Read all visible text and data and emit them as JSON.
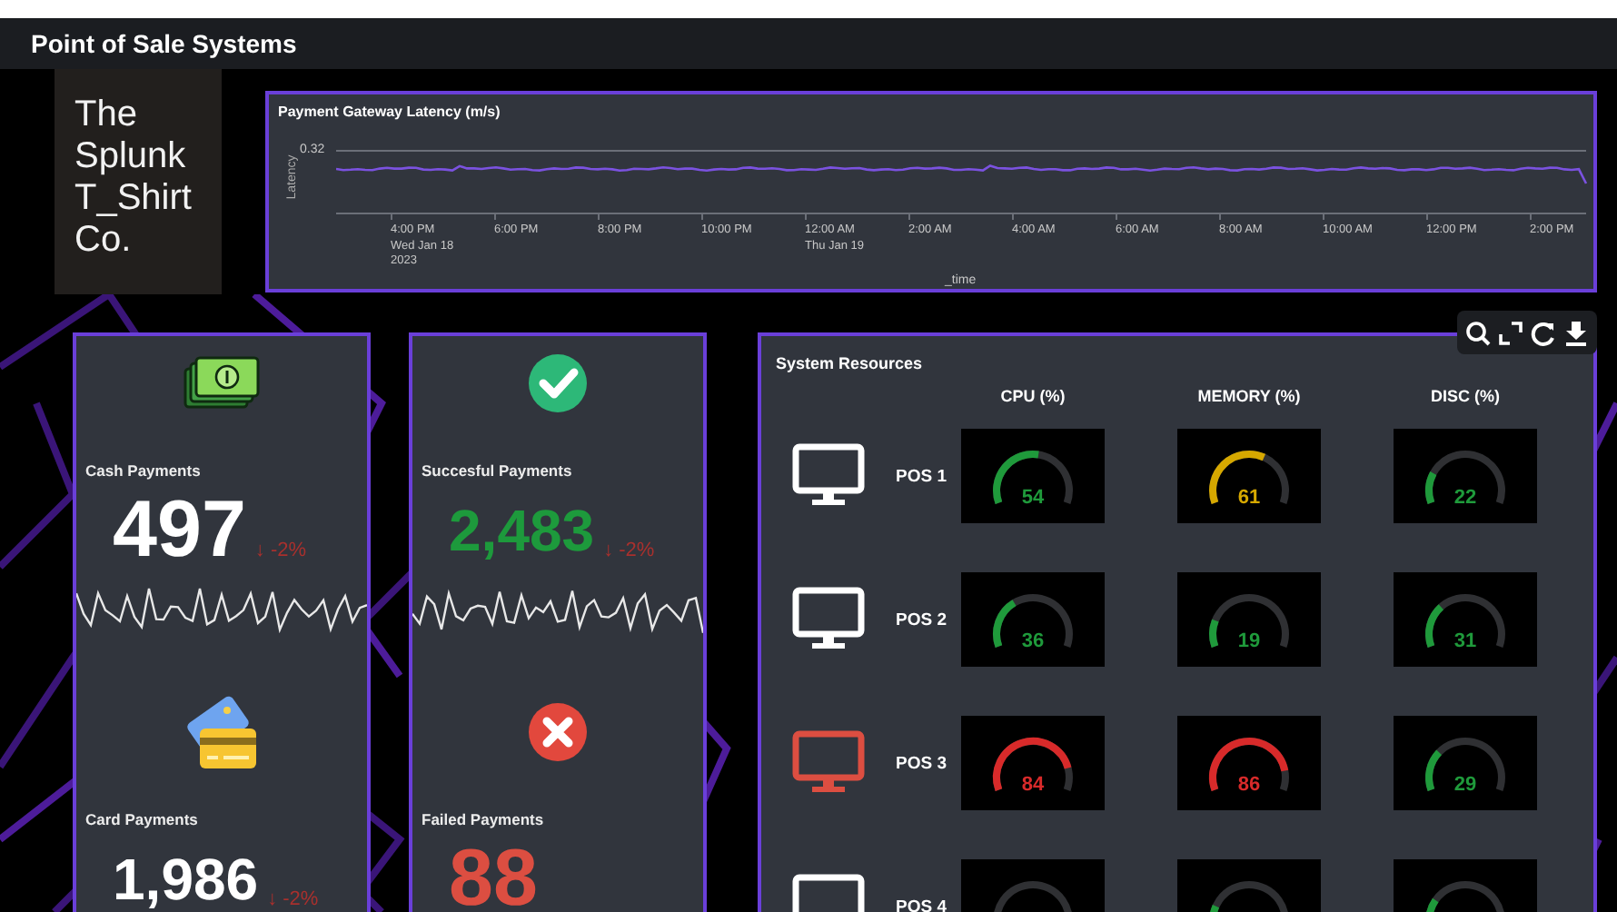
{
  "header": {
    "title": "Point of Sale Systems"
  },
  "logo": {
    "lines": [
      "The",
      "Splunk",
      "T_Shirt",
      "Co."
    ]
  },
  "latency_chart": {
    "title": "Payment Gateway Latency (m/s)",
    "ylabel": "Latency",
    "ytick": "0.32",
    "xlabel": "_time",
    "xticks": [
      {
        "lines": [
          "4:00 PM",
          "Wed Jan 18",
          "2023"
        ]
      },
      {
        "lines": [
          "6:00 PM"
        ]
      },
      {
        "lines": [
          "8:00 PM"
        ]
      },
      {
        "lines": [
          "10:00 PM"
        ]
      },
      {
        "lines": [
          "12:00 AM",
          "Thu Jan 19"
        ]
      },
      {
        "lines": [
          "2:00 AM"
        ]
      },
      {
        "lines": [
          "4:00 AM"
        ]
      },
      {
        "lines": [
          "6:00 AM"
        ]
      },
      {
        "lines": [
          "8:00 AM"
        ]
      },
      {
        "lines": [
          "10:00 AM"
        ]
      },
      {
        "lines": [
          "12:00 PM"
        ]
      },
      {
        "lines": [
          "2:00 PM"
        ]
      }
    ]
  },
  "metric_columns": [
    {
      "metrics": [
        {
          "kind": "cash",
          "label": "Cash Payments",
          "value": "497",
          "delta": "↓ -2%",
          "sparkline": true
        },
        {
          "kind": "card",
          "label": "Card Payments",
          "value": "1,986",
          "delta": "↓ -2%"
        }
      ]
    },
    {
      "metrics": [
        {
          "kind": "success",
          "label": "Succesful Payments",
          "value": "2,483",
          "delta": "↓ -2%",
          "sparkline": true
        },
        {
          "kind": "failure",
          "label": "Failed Payments",
          "value": "88"
        }
      ]
    }
  ],
  "system_resources": {
    "title": "System Resources",
    "columns": [
      "CPU (%)",
      "MEMORY (%)",
      "DISC (%)"
    ],
    "rows": [
      {
        "name": "POS 1",
        "alert": false,
        "gauges": [
          {
            "value": "54"
          },
          {
            "value": "61"
          },
          {
            "value": "22"
          }
        ]
      },
      {
        "name": "POS 2",
        "alert": false,
        "gauges": [
          {
            "value": "36"
          },
          {
            "value": "19"
          },
          {
            "value": "31"
          }
        ]
      },
      {
        "name": "POS 3",
        "alert": true,
        "gauges": [
          {
            "value": "84"
          },
          {
            "value": "86"
          },
          {
            "value": "29"
          }
        ]
      },
      {
        "name": "POS 4",
        "alert": false
      }
    ]
  },
  "toolbar": {
    "buttons": [
      {
        "kind": "search"
      },
      {
        "kind": "expand"
      },
      {
        "kind": "refresh"
      },
      {
        "kind": "download"
      }
    ]
  }
}
